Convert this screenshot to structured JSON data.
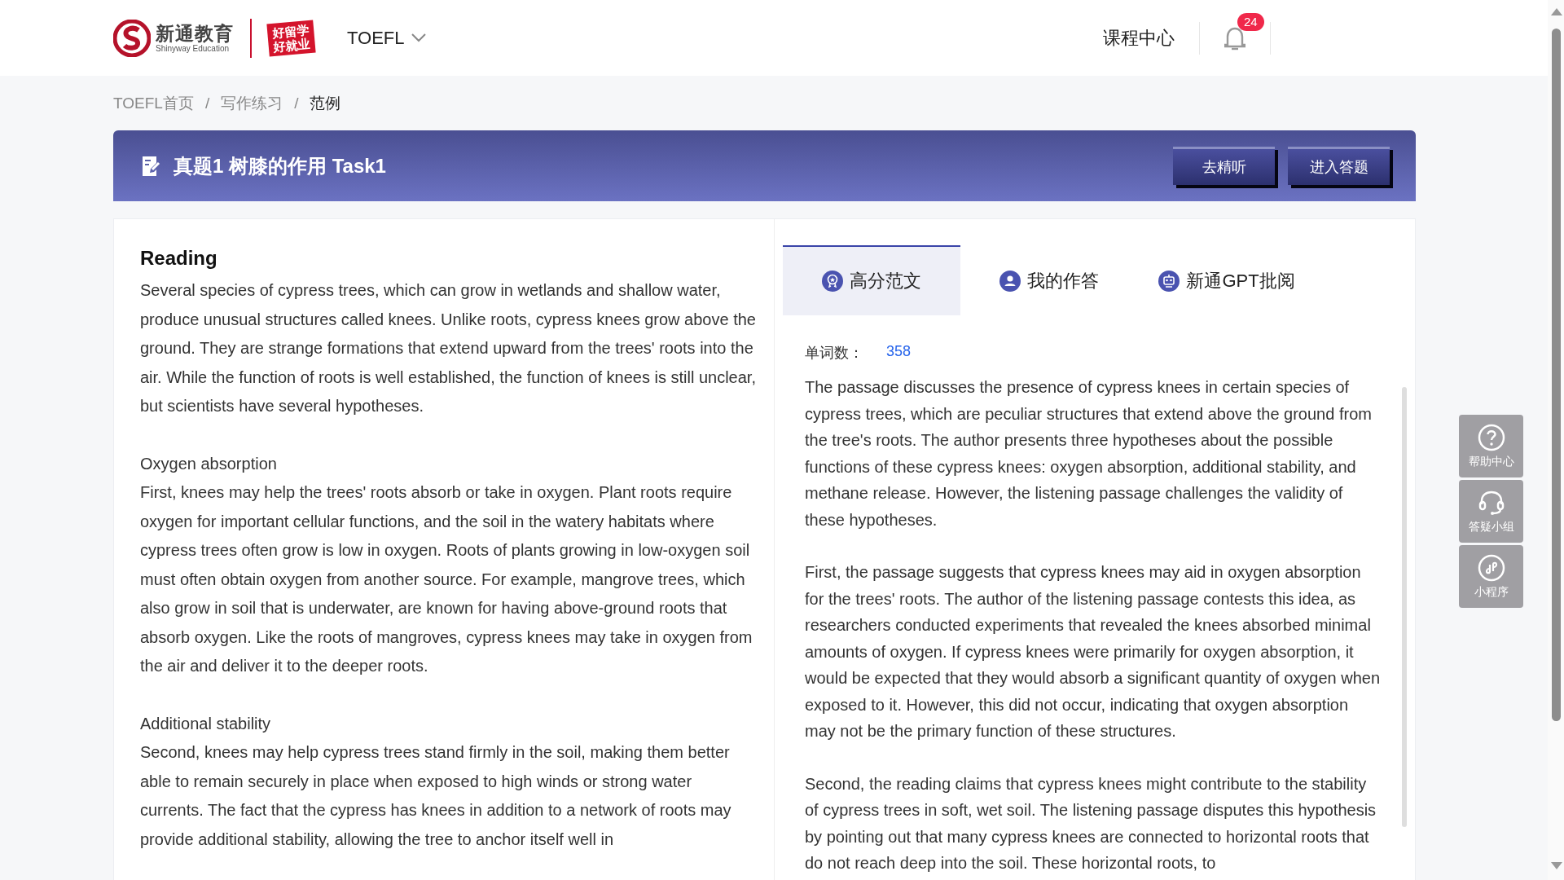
{
  "header": {
    "logo": {
      "name": "新通教育",
      "subtitle": "Shinyway Education"
    },
    "slogan": [
      "好留学",
      "好就业"
    ],
    "exam_menu": "TOEFL",
    "nav": [
      "课程中心"
    ],
    "notifications": {
      "count": "24"
    }
  },
  "breadcrumb": {
    "items": [
      {
        "label": "TOEFL首页",
        "current": false
      },
      {
        "label": "写作练习",
        "current": false
      },
      {
        "label": "范例",
        "current": true
      }
    ],
    "separators": [
      "/",
      "/"
    ]
  },
  "title_bar": {
    "title": "真题1 树膝的作用 Task1",
    "buttons": [
      "去精听",
      "进入答题"
    ]
  },
  "reading": {
    "heading": "Reading",
    "sections": [
      {
        "text": "Several species of cypress trees, which can grow in wetlands and shallow water, produce unusual structures called knees. Unlike roots, cypress knees grow above the ground. They are strange formations that extend upward from the trees' roots into the air. While the function of roots is well established, the function of knees is still unclear, but scientists have several hypotheses."
      },
      {
        "heading": "Oxygen absorption",
        "text": "First, knees may help the trees' roots absorb or take in oxygen. Plant roots require oxygen for important cellular functions, and the soil in the watery habitats where cypress trees often grow is low in oxygen. Roots of plants growing in low-oxygen soil must often obtain oxygen from another source. For example, mangrove trees, which also grow in soil that is underwater, are known for having above-ground roots that absorb oxygen. Like the roots of mangroves, cypress knees may take in oxygen from the air and deliver it to the deeper roots."
      },
      {
        "heading": "Additional stability",
        "text": "Second, knees may help cypress trees stand firmly in the soil, making them better able to remain securely in place when exposed to high winds or strong water currents. The fact that the cypress has knees in addition to a network of roots may provide additional stability, allowing the tree to anchor itself well in"
      }
    ]
  },
  "answer": {
    "tabs": [
      {
        "label": "高分范文",
        "selected": true
      },
      {
        "label": "我的作答",
        "selected": false
      },
      {
        "label": "新通GPT批阅",
        "selected": false
      }
    ],
    "word_count": {
      "label": "单词数：",
      "value": "358"
    },
    "paragraphs": [
      "The passage discusses the presence of cypress knees in certain species of cypress trees, which are peculiar structures that extend above the ground from the tree's roots. The author presents three hypotheses about the possible functions of these cypress knees: oxygen absorption, additional stability, and methane release. However, the listening passage challenges the validity of these hypotheses.",
      "First, the passage suggests that cypress knees may aid in oxygen absorption for the trees' roots. The author of the listening passage contests this idea, as researchers conducted experiments that revealed the knees absorbed minimal amounts of oxygen. If cypress knees were primarily for oxygen absorption, it would be expected that they would absorb a significant quantity of oxygen when exposed to it. However, this did not occur, indicating that oxygen absorption may not be the primary function of these structures.",
      "Second, the reading claims that cypress knees might contribute to the stability of cypress trees in soft, wet soil. The listening passage disputes this hypothesis by pointing out that many cypress knees are connected to horizontal roots that do not reach deep into the soil. These horizontal roots, to"
    ]
  },
  "side_tools": [
    "帮助中心",
    "答疑小组",
    "小程序"
  ]
}
